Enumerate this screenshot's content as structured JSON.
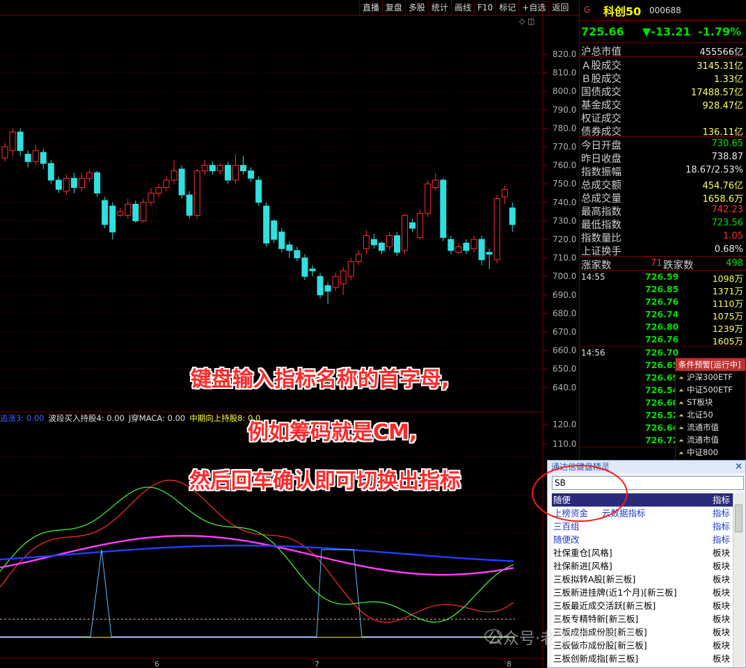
{
  "toolbar": {
    "items": [
      "直播",
      "复盘",
      "多股",
      "统计",
      "画线",
      "F10",
      "标记",
      "+自选",
      "返回"
    ]
  },
  "chart": {
    "price_axis": [
      "820.0",
      "810.0",
      "800.0",
      "790.0",
      "780.0",
      "770.0",
      "760.0",
      "750.0",
      "740.0",
      "730.0",
      "720.0",
      "710.0",
      "700.0",
      "690.0",
      "680.0",
      "670.0",
      "660.0",
      "650.0",
      "640.0"
    ],
    "indicator_axis": [
      "120.0",
      "110.0"
    ],
    "date_labels": [
      "6",
      "7",
      "8"
    ],
    "corner_icons": "◇ ◫",
    "indicator_legend": [
      {
        "text": "追涨3: 0.00",
        "color": "#4060ff"
      },
      {
        "text": "波段买入持股4: 0.00",
        "color": "#e0e0e0"
      },
      {
        "text": "J穿MACA: 0.00",
        "color": "#e0e0e0"
      },
      {
        "text": "中期向上持股8: 0.0",
        "color": "#ffff40"
      }
    ]
  },
  "chart_data": {
    "type": "candlestick",
    "ylim": [
      630,
      825
    ],
    "candles": [
      [
        764,
        770,
        762,
        772
      ],
      [
        768,
        778,
        765,
        780
      ],
      [
        778,
        768,
        765,
        780
      ],
      [
        766,
        762,
        759,
        768
      ],
      [
        762,
        768,
        760,
        771
      ],
      [
        767,
        761,
        758,
        769
      ],
      [
        761,
        752,
        750,
        763
      ],
      [
        752,
        747,
        745,
        754
      ],
      [
        746,
        753,
        744,
        755
      ],
      [
        753,
        748,
        745,
        756
      ],
      [
        748,
        753,
        746,
        756
      ],
      [
        753,
        756,
        751,
        758
      ],
      [
        756,
        745,
        743,
        757
      ],
      [
        741,
        728,
        726,
        743
      ],
      [
        738,
        724,
        720,
        740
      ],
      [
        733,
        735,
        732,
        737
      ],
      [
        733,
        739,
        731,
        742
      ],
      [
        739,
        730,
        729,
        741
      ],
      [
        730,
        740,
        729,
        742
      ],
      [
        740,
        745,
        738,
        748
      ],
      [
        745,
        748,
        743,
        750
      ],
      [
        748,
        752,
        746,
        754
      ],
      [
        752,
        757,
        750,
        763
      ],
      [
        758,
        744,
        742,
        760
      ],
      [
        744,
        733,
        731,
        746
      ],
      [
        733,
        757,
        731,
        758
      ],
      [
        757,
        760,
        755,
        763
      ],
      [
        760,
        757,
        755,
        762
      ],
      [
        757,
        760,
        755,
        761
      ],
      [
        760,
        752,
        750,
        762
      ],
      [
        752,
        760,
        750,
        766
      ],
      [
        760,
        757,
        755,
        765
      ],
      [
        757,
        753,
        751,
        759
      ],
      [
        752,
        740,
        738,
        754
      ],
      [
        738,
        718,
        716,
        740
      ],
      [
        730,
        720,
        718,
        731
      ],
      [
        724,
        715,
        713,
        726
      ],
      [
        717,
        714,
        710,
        719
      ],
      [
        714,
        710,
        708,
        716
      ],
      [
        710,
        700,
        698,
        712
      ],
      [
        704,
        703,
        700,
        706
      ],
      [
        700,
        690,
        688,
        702
      ],
      [
        695,
        692,
        685,
        697
      ],
      [
        694,
        700,
        692,
        702
      ],
      [
        696,
        703,
        690,
        705
      ],
      [
        700,
        708,
        698,
        710
      ],
      [
        708,
        712,
        706,
        714
      ],
      [
        715,
        722,
        712,
        725
      ],
      [
        720,
        717,
        715,
        723
      ],
      [
        718,
        714,
        712,
        719
      ],
      [
        716,
        722,
        714,
        724
      ],
      [
        722,
        713,
        711,
        724
      ],
      [
        714,
        733,
        712,
        734
      ],
      [
        729,
        726,
        724,
        731
      ],
      [
        721,
        734,
        720,
        736
      ],
      [
        734,
        750,
        732,
        752
      ],
      [
        748,
        752,
        746,
        756
      ],
      [
        752,
        721,
        719,
        753
      ],
      [
        720,
        714,
        712,
        722
      ],
      [
        713,
        716,
        712,
        718
      ],
      [
        718,
        714,
        712,
        720
      ],
      [
        715,
        720,
        713,
        722
      ],
      [
        720,
        709,
        706,
        722
      ],
      [
        713,
        712,
        704,
        715
      ],
      [
        709,
        742,
        707,
        744
      ],
      [
        743,
        747,
        739,
        749
      ],
      [
        737,
        728,
        724,
        740
      ]
    ]
  },
  "stock": {
    "flag": "G",
    "name": "科创50",
    "code": "000688",
    "price": "725.66",
    "change": "▼-13.21",
    "pct": "-1.79%"
  },
  "stats": {
    "market_cap": {
      "label": "沪总市值",
      "value": "455566亿"
    },
    "turnover": [
      {
        "label": "Ａ股成交",
        "value": "3145.31亿"
      },
      {
        "label": "Ｂ股成交",
        "value": "1.33亿"
      },
      {
        "label": "国债成交",
        "value": "17488.57亿"
      },
      {
        "label": "基金成交",
        "value": "928.47亿"
      },
      {
        "label": "权证成交",
        "value": ""
      },
      {
        "label": "债券成交",
        "value": "136.11亿"
      }
    ],
    "index": [
      {
        "label": "今日开盘",
        "value": "730.65",
        "color": "c-green"
      },
      {
        "label": "昨日收盘",
        "value": "738.87",
        "color": "c-white"
      },
      {
        "label": "指数振幅",
        "value": "18.67/2.53%",
        "color": "c-white"
      },
      {
        "label": "总成交额",
        "value": "454.76亿",
        "color": "c-yellow"
      },
      {
        "label": "总成交量",
        "value": "1658.6万",
        "color": "c-yellow"
      },
      {
        "label": "最高指数",
        "value": "742.23",
        "color": "c-red"
      },
      {
        "label": "最低指数",
        "value": "723.56",
        "color": "c-green"
      },
      {
        "label": "指数量比",
        "value": "1.05",
        "color": "c-red"
      },
      {
        "label": "上证换手",
        "value": "0.68%",
        "color": "c-white"
      }
    ],
    "up_label": "涨家数",
    "up_count": "71",
    "down_label": "跌家数",
    "down_count": "498"
  },
  "ticks": [
    {
      "time": "14:55",
      "rows": [
        {
          "p": "726.59",
          "v": "1098万"
        },
        {
          "p": "726.85",
          "v": "1371万"
        },
        {
          "p": "726.76",
          "v": "1110万"
        },
        {
          "p": "726.74",
          "v": "1075万"
        },
        {
          "p": "726.80",
          "v": "1239万"
        },
        {
          "p": "726.76",
          "v": "1605万"
        }
      ]
    },
    {
      "time": "14:56",
      "rows": [
        {
          "p": "726.70",
          "v": ""
        },
        {
          "p": "726.65",
          "v": ""
        },
        {
          "p": "726.69",
          "v": ""
        },
        {
          "p": "726.54",
          "v": ""
        },
        {
          "p": "726.60",
          "v": ""
        },
        {
          "p": "726.52",
          "v": ""
        },
        {
          "p": "726.64",
          "v": ""
        },
        {
          "p": "726.72",
          "v": ""
        }
      ]
    }
  ],
  "alert": {
    "title": "条件预警[运行中]",
    "items": [
      "沪深300ETF",
      "中证500ETF",
      "ST板块",
      "北证50",
      "流通市值",
      "流通市值",
      "中证800"
    ]
  },
  "wizard": {
    "title": "通达信键盘精灵",
    "close": "×",
    "input_value": "SB",
    "rows": [
      {
        "name": "随便",
        "extra": "",
        "type": "指标",
        "style": "sel"
      },
      {
        "name": "上榜资金",
        "extra": "云数据指标",
        "type": "指标",
        "style": "ind"
      },
      {
        "name": "三百组",
        "extra": "",
        "type": "指标",
        "style": "ind"
      },
      {
        "name": "随便改",
        "extra": "",
        "type": "指标",
        "style": "ind"
      },
      {
        "name": "社保重仓[风格]",
        "extra": "",
        "type": "板块",
        "style": ""
      },
      {
        "name": "社保新进[风格]",
        "extra": "",
        "type": "板块",
        "style": ""
      },
      {
        "name": "三板拟转A股[新三板]",
        "extra": "",
        "type": "板块",
        "style": ""
      },
      {
        "name": "三板新进挂牌(近1个月)[新三板]",
        "extra": "",
        "type": "板块",
        "style": ""
      },
      {
        "name": "三板最近成交活跃[新三板]",
        "extra": "",
        "type": "板块",
        "style": ""
      },
      {
        "name": "三板专精特新[新三板]",
        "extra": "",
        "type": "板块",
        "style": ""
      },
      {
        "name": "三板成指成份股[新三板]",
        "extra": "",
        "type": "板块",
        "style": ""
      },
      {
        "name": "三板做市成份股[新三板]",
        "extra": "",
        "type": "板块",
        "style": ""
      },
      {
        "name": "三板创新成指[新三板]",
        "extra": "",
        "type": "板块",
        "style": ""
      }
    ]
  },
  "annotations": {
    "line1": "键盘输入指标名称的首字母,",
    "line2": "例如筹码就是CM,",
    "line3": "然后回车确认即可切换出指标"
  },
  "watermark": "公众号·老王的大局观"
}
